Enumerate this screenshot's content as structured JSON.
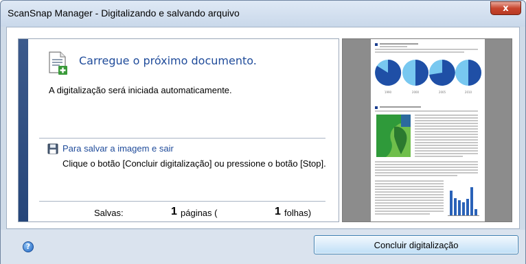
{
  "window": {
    "title": "ScanSnap Manager - Digitalizando e salvando arquivo",
    "close_label": "x"
  },
  "status": {
    "heading": "Carregue o próximo documento.",
    "auto_text": "A digitalização será iniciada automaticamente."
  },
  "save_info": {
    "title": "Para salvar a imagem e sair",
    "description": "Clique o botão [Concluir digitalização] ou pressione o botão [Stop]."
  },
  "saved": {
    "label": "Salvas:",
    "pages_count": "1",
    "pages_unit": "páginas (",
    "sheets_count": "1",
    "sheets_unit": "folhas)"
  },
  "preview": {
    "chart_labels": [
      "1990",
      "2000",
      "2005",
      "2010"
    ]
  },
  "footer": {
    "help_label": "?",
    "finish_button": "Concluir digitalização"
  },
  "colors": {
    "accent": "#1f4b9a",
    "panel_bar": "#26467a",
    "preview_bg": "#8c8c8c"
  }
}
